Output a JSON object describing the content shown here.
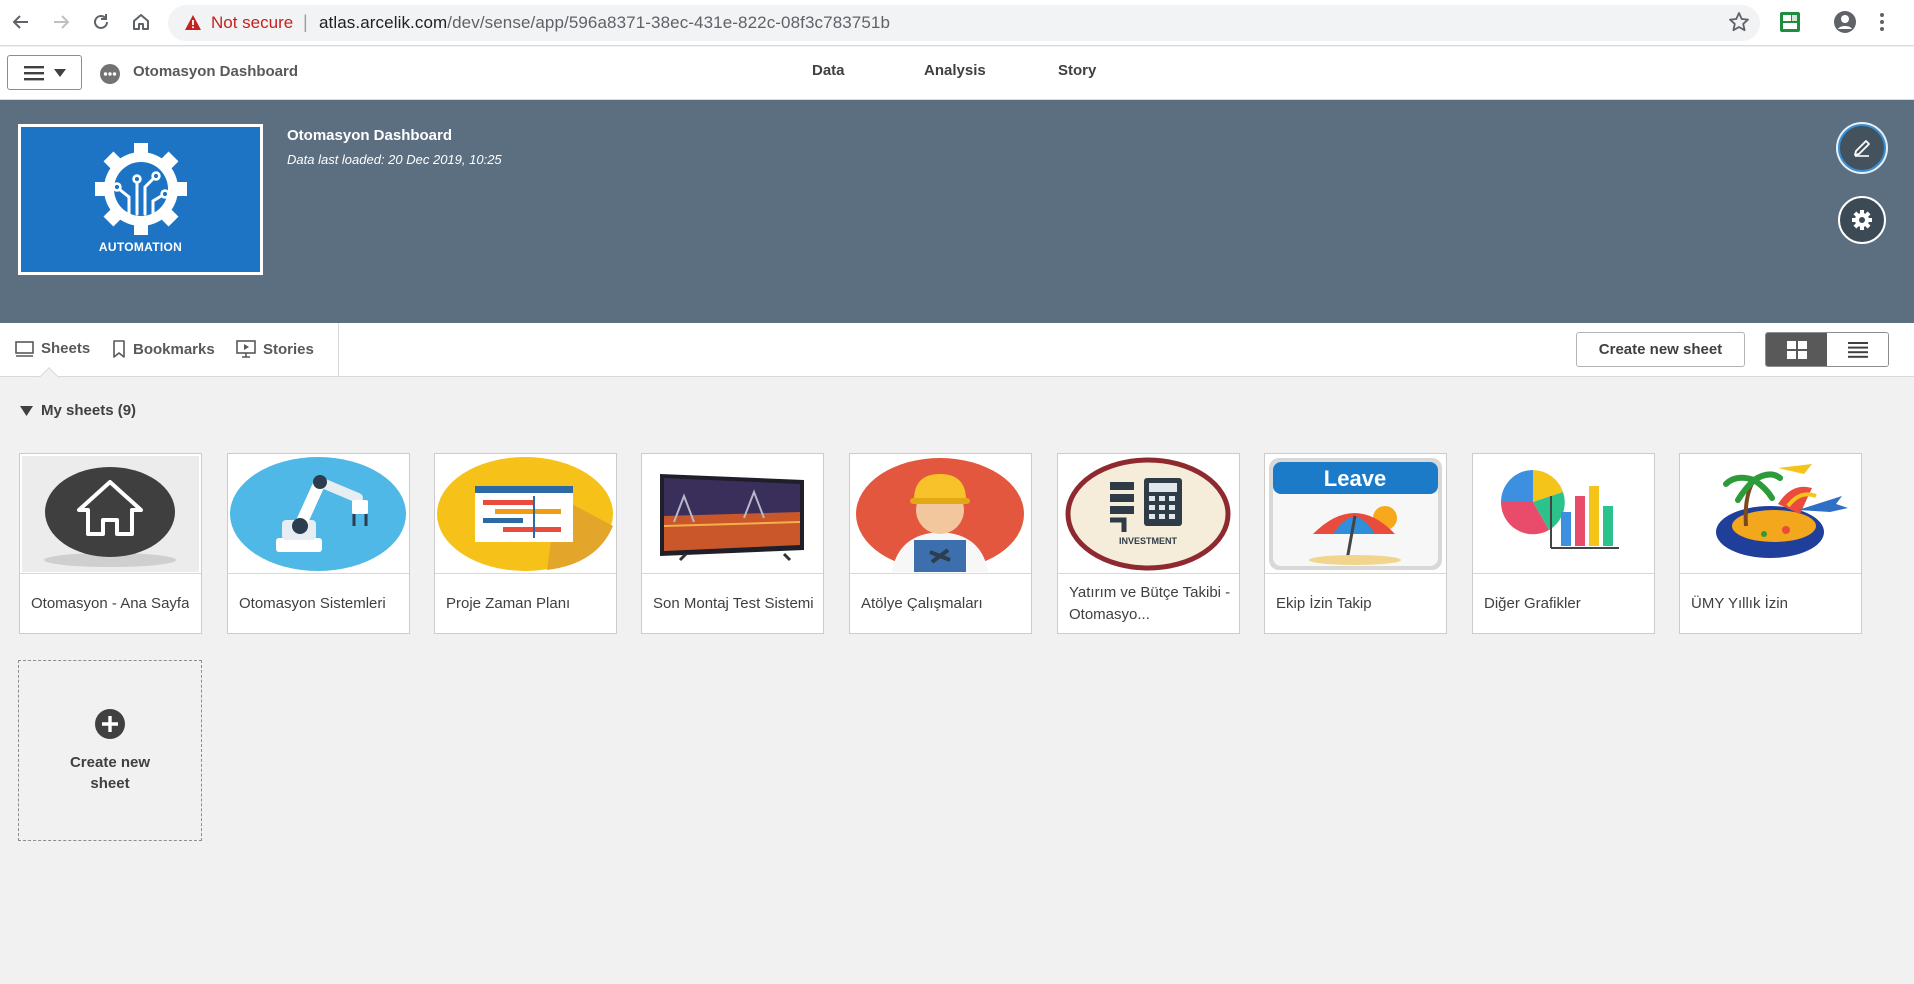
{
  "browser": {
    "security_label": "Not secure",
    "separator": "|",
    "url_host": "atlas.arcelik.com",
    "url_path": "/dev/sense/app/596a8371-38ec-431e-822c-08f3c783751b"
  },
  "toolbar": {
    "app_name": "Otomasyon Dashboard",
    "tabs": [
      "Data",
      "Analysis",
      "Story"
    ]
  },
  "header": {
    "title": "Otomasyon Dashboard",
    "subtitle": "Data last loaded: 20 Dec 2019, 10:25",
    "thumbnail_label": "AUTOMATION",
    "accent_color": "#5b6f80"
  },
  "subbar": {
    "tabs": [
      {
        "label": "Sheets",
        "icon": "sheets-icon"
      },
      {
        "label": "Bookmarks",
        "icon": "bookmark-icon"
      },
      {
        "label": "Stories",
        "icon": "stories-icon"
      }
    ],
    "create_label": "Create new sheet"
  },
  "sheets": {
    "heading": "My sheets (9)",
    "items": [
      {
        "title": "Otomasyon - Ana Sayfa",
        "icon": "home-icon"
      },
      {
        "title": "Otomasyon Sistemleri",
        "icon": "robot-arm-icon"
      },
      {
        "title": "Proje Zaman Planı",
        "icon": "timeline-chart-icon"
      },
      {
        "title": "Son Montaj Test Sistemi",
        "icon": "tv-icon"
      },
      {
        "title": "Atölye Çalışmaları",
        "icon": "worker-icon"
      },
      {
        "title": "Yatırım ve Bütçe Takibi - Otomasyo...",
        "icon": "investment-calculator-icon"
      },
      {
        "title": "Ekip İzin Takip",
        "icon": "leave-calendar-icon"
      },
      {
        "title": "Diğer Grafikler",
        "icon": "charts-icon"
      },
      {
        "title": "ÜMY Yıllık İzin",
        "icon": "island-holiday-icon"
      }
    ],
    "new_card_label": "Create new sheet"
  }
}
